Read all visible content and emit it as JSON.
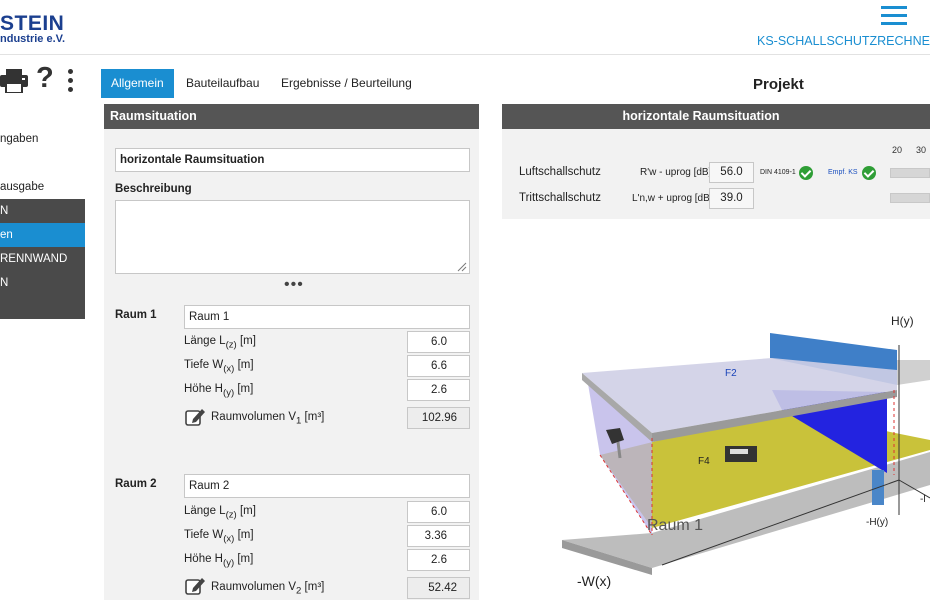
{
  "header": {
    "logo_main": "STEIN",
    "logo_sub": "ndustrie e.V.",
    "app_title": "KS-SCHALLSCHUTZRECHNER"
  },
  "toolbar": {
    "printer_icon": "printer-icon",
    "help_icon": "?",
    "menu_icon": "kebab-icon"
  },
  "sidebar": {
    "items": [
      {
        "label": "ngaben",
        "style": "light"
      },
      {
        "label": "",
        "style": "light"
      },
      {
        "label": "ausgabe",
        "style": "light"
      },
      {
        "label": "N",
        "style": "dark"
      },
      {
        "label": "en",
        "style": "active"
      },
      {
        "label": "RENNWAND",
        "style": "dark"
      },
      {
        "label": "N",
        "style": "dark"
      },
      {
        "label": "",
        "style": "dark"
      }
    ]
  },
  "tabs": [
    {
      "label": "Allgemein",
      "active": true
    },
    {
      "label": "Bauteilaufbau",
      "active": false
    },
    {
      "label": "Ergebnisse / Beurteilung",
      "active": false
    }
  ],
  "projekt_title": "Projekt",
  "left_panel": {
    "title": "Raumsituation",
    "situation_value": "horizontale Raumsituation",
    "beschreibung_label": "Beschreibung",
    "beschreibung_value": "",
    "more_dots": "•••",
    "raum1": {
      "label": "Raum 1",
      "name": "Raum 1",
      "laenge_label": "Länge L",
      "laenge_sub": "(z)",
      "laenge_unit": " [m]",
      "laenge": "6.0",
      "tiefe_label": "Tiefe W",
      "tiefe_sub": "(x)",
      "tiefe_unit": " [m]",
      "tiefe": "6.6",
      "hoehe_label": "Höhe H",
      "hoehe_sub": "(y)",
      "hoehe_unit": " [m]",
      "hoehe": "2.6",
      "volumen_label": "Raumvolumen V",
      "volumen_sub": "1",
      "volumen_unit": " [m³]",
      "volumen": "102.96"
    },
    "raum2": {
      "label": "Raum 2",
      "name": "Raum 2",
      "laenge_label": "Länge L",
      "laenge_sub": "(z)",
      "laenge_unit": " [m]",
      "laenge": "6.0",
      "tiefe_label": "Tiefe W",
      "tiefe_sub": "(x)",
      "tiefe_unit": " [m]",
      "tiefe": "3.36",
      "hoehe_label": "Höhe H",
      "hoehe_sub": "(y)",
      "hoehe_unit": " [m]",
      "hoehe": "2.6",
      "volumen_label": "Raumvolumen V",
      "volumen_sub": "2",
      "volumen_unit": " [m³]",
      "volumen": "52.42"
    }
  },
  "right_panel": {
    "title": "horizontale Raumsituation",
    "luft": {
      "label": "Luftschallschutz",
      "formula": "R'w - uprog [dB]",
      "value": "56.0",
      "din_label": "DIN 4109-1",
      "empf_label": "Empf. KS"
    },
    "tritt": {
      "label": "Trittschallschutz",
      "formula": "L'n,w + uprog [dB]",
      "value": "39.0"
    },
    "scale_labels": [
      "20",
      "30"
    ],
    "scene": {
      "label_hy": "H(y)",
      "label_neg_hy": "-H(y)",
      "label_neg_wx": "-W(x)",
      "label_f2": "F2",
      "label_f4": "F4",
      "room_label": "Raum 1",
      "label_neg_edge": "-l"
    }
  },
  "colors": {
    "accent": "#1a8ed1",
    "header_dark": "#555555",
    "sidebar_dark": "#4a4a4a",
    "check_green": "#2f9e36",
    "floor_yellow": "#c9c23a",
    "wall_blue": "#2a2ad8"
  }
}
